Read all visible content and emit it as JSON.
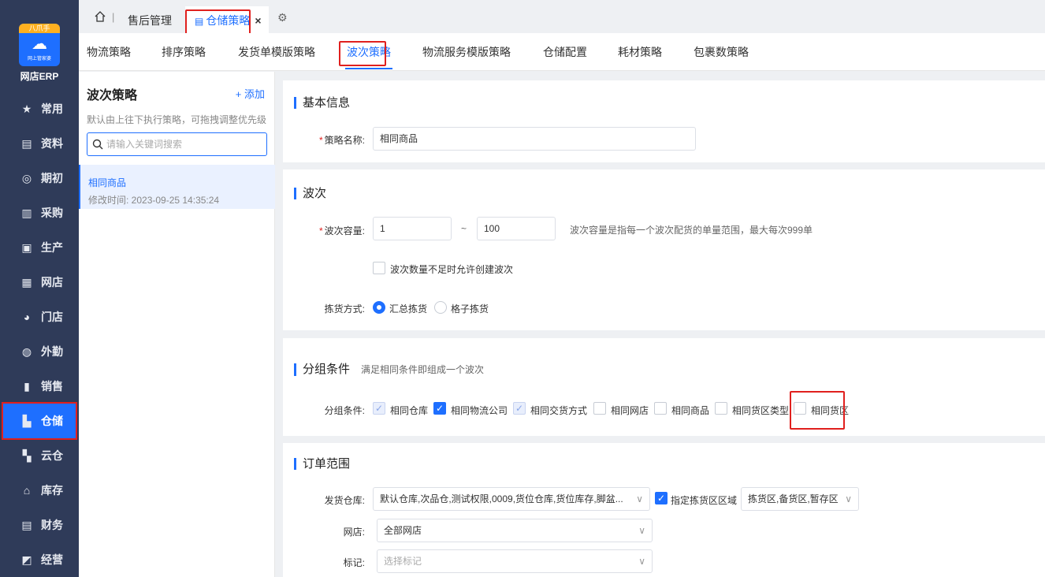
{
  "sidebar": {
    "logo_badge": "八爪手",
    "logo_sub": "网上管家婆",
    "brand": "网店ERP",
    "items": [
      {
        "label": "常用",
        "icon": "star-icon",
        "glyph": "★"
      },
      {
        "label": "资料",
        "icon": "document-icon",
        "glyph": "▤"
      },
      {
        "label": "期初",
        "icon": "target-icon",
        "glyph": "◎"
      },
      {
        "label": "采购",
        "icon": "cart-icon",
        "glyph": "▥"
      },
      {
        "label": "生产",
        "icon": "factory-icon",
        "glyph": "▣"
      },
      {
        "label": "网店",
        "icon": "shop-icon",
        "glyph": "▦"
      },
      {
        "label": "门店",
        "icon": "pie-icon",
        "glyph": "◕"
      },
      {
        "label": "外勤",
        "icon": "compass-icon",
        "glyph": "◍"
      },
      {
        "label": "销售",
        "icon": "bar-chart-icon",
        "glyph": "▮"
      },
      {
        "label": "仓储",
        "icon": "warehouse-icon",
        "glyph": "▙"
      },
      {
        "label": "云仓",
        "icon": "cloud-warehouse-icon",
        "glyph": "▚"
      },
      {
        "label": "库存",
        "icon": "home-stock-icon",
        "glyph": "⌂"
      },
      {
        "label": "财务",
        "icon": "finance-icon",
        "glyph": "▤"
      },
      {
        "label": "经营",
        "icon": "business-icon",
        "glyph": "◩"
      }
    ],
    "active_index": 9
  },
  "topbar": {
    "tab_aftersale": "售后管理",
    "tab_active": "仓储策略",
    "close": "×"
  },
  "subtabs": [
    "物流策略",
    "排序策略",
    "发货单模版策略",
    "波次策略",
    "物流服务模版策略",
    "仓储配置",
    "耗材策略",
    "包裹数策略"
  ],
  "subtab_active": "波次策略",
  "left_panel": {
    "title": "波次策略",
    "add": "+ 添加",
    "hint": "默认由上往下执行策略，可拖拽调整优先级",
    "search_placeholder": "请输入关键词搜索",
    "item_name": "相同商品",
    "item_time": "修改时间: 2023-09-25 14:35:24"
  },
  "basic": {
    "title": "基本信息",
    "name_label": "策略名称:",
    "name_value": "相同商品"
  },
  "wave": {
    "title": "波次",
    "capacity_label": "波次容量:",
    "min": "1",
    "tilde": "~",
    "max": "100",
    "capacity_note": "波次容量是指每一个波次配货的单量范围，最大每次999单",
    "allow_label": "波次数量不足时允许创建波次",
    "pick_label": "拣货方式:",
    "pick_option_1": "汇总拣货",
    "pick_option_2": "格子拣货"
  },
  "grouping": {
    "title": "分组条件",
    "subtitle": "满足相同条件即组成一个波次",
    "label": "分组条件:",
    "options": [
      {
        "label": "相同仓库",
        "state": "checked-disabled"
      },
      {
        "label": "相同物流公司",
        "state": "checked"
      },
      {
        "label": "相同交货方式",
        "state": "checked-disabled"
      },
      {
        "label": "相同网店",
        "state": "unchecked"
      },
      {
        "label": "相同商品",
        "state": "unchecked"
      },
      {
        "label": "相同货区类型",
        "state": "unchecked"
      },
      {
        "label": "相同货区",
        "state": "unchecked"
      }
    ]
  },
  "order_scope": {
    "title": "订单范围",
    "warehouse_label": "发货仓库:",
    "warehouse_value": "默认仓库,次品仓,测试权限,0009,货位仓库,货位库存,脚盆...",
    "zone_check_label": "指定拣货区区域",
    "zone_value": "拣货区,备货区,暂存区",
    "shop_label": "网店:",
    "shop_value": "全部网店",
    "mark_label": "标记:",
    "mark_placeholder": "选择标记"
  },
  "colors": {
    "accent": "#1e6fff",
    "sidebar": "#2f3b59",
    "highlight": "#e0201e"
  }
}
